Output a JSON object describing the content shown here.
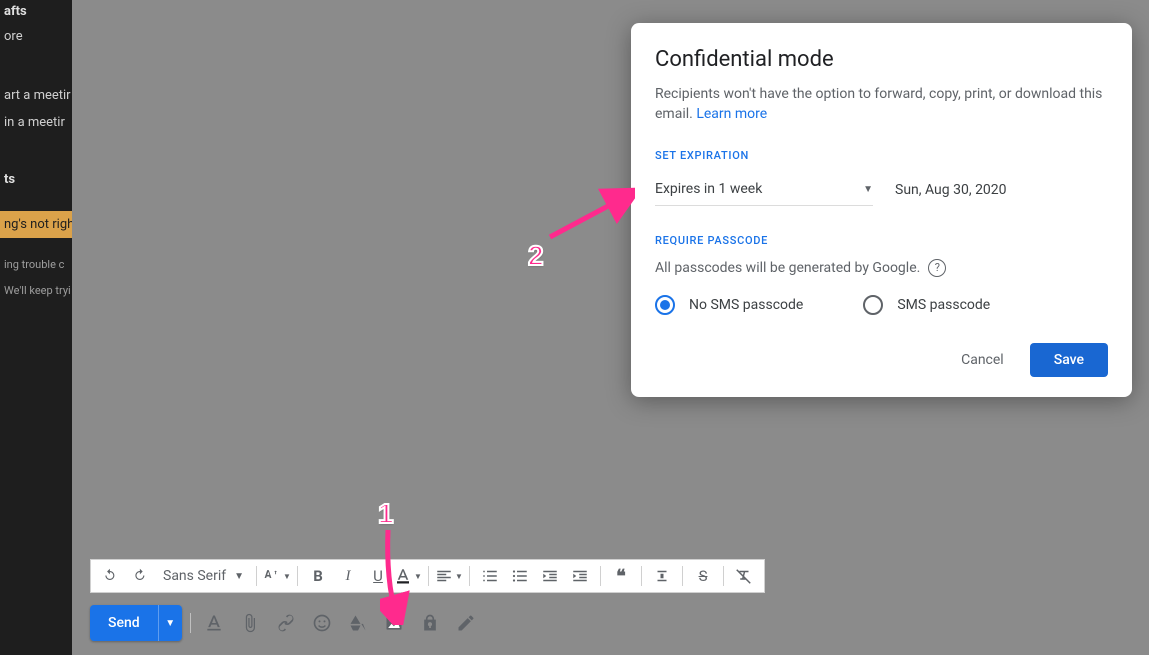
{
  "sidebar": {
    "drafts": "afts",
    "more": "ore",
    "start_meeting": "art a meetir",
    "join_meeting": "in a meetir",
    "section2": "ts",
    "highlight": "ng's not righ",
    "trouble1": "ing trouble c",
    "trouble2": "We'll keep tryi"
  },
  "toolbar": {
    "font": "Sans Serif"
  },
  "send": {
    "label": "Send"
  },
  "dialog": {
    "title": "Confidential mode",
    "desc": "Recipients won't have the option to forward, copy, print, or download this email.",
    "learn_more": "Learn more",
    "section_expiration": "SET EXPIRATION",
    "expiration_value": "Expires in 1 week",
    "expiration_date": "Sun, Aug 30, 2020",
    "section_passcode": "REQUIRE PASSCODE",
    "passcode_desc": "All passcodes will be generated by Google.",
    "radio_no_sms": "No SMS passcode",
    "radio_sms": "SMS passcode",
    "cancel": "Cancel",
    "save": "Save"
  },
  "annotations": {
    "n1": "1",
    "n2": "2"
  }
}
